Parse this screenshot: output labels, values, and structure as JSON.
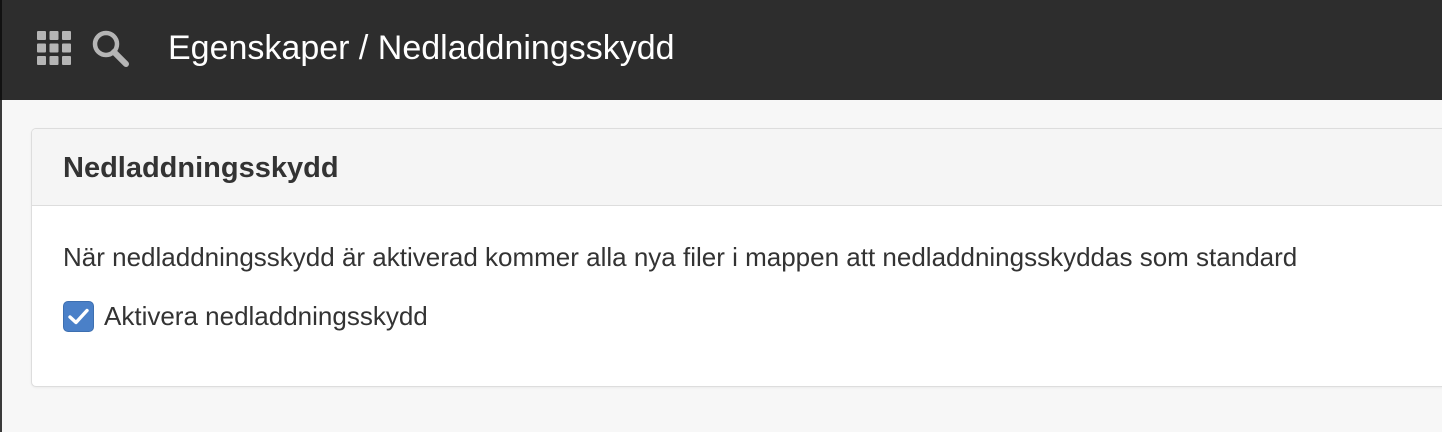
{
  "colors": {
    "topbar_bg": "#2d2d2d",
    "page_bg": "#f7f7f7",
    "panel_heading_bg": "#f5f5f5",
    "checkbox_accent": "#4a80c8",
    "text": "#333333"
  },
  "topbar": {
    "apps_icon": "grid-icon",
    "search_icon": "search-icon",
    "title": "Egenskaper / Nedladdningsskydd"
  },
  "panel": {
    "title": "Nedladdningsskydd",
    "description": "När nedladdningsskydd är aktiverad kommer alla nya filer i mappen att nedladdningsskyddas som standard",
    "checkbox": {
      "label": "Aktivera nedladdningsskydd",
      "checked": true
    }
  }
}
